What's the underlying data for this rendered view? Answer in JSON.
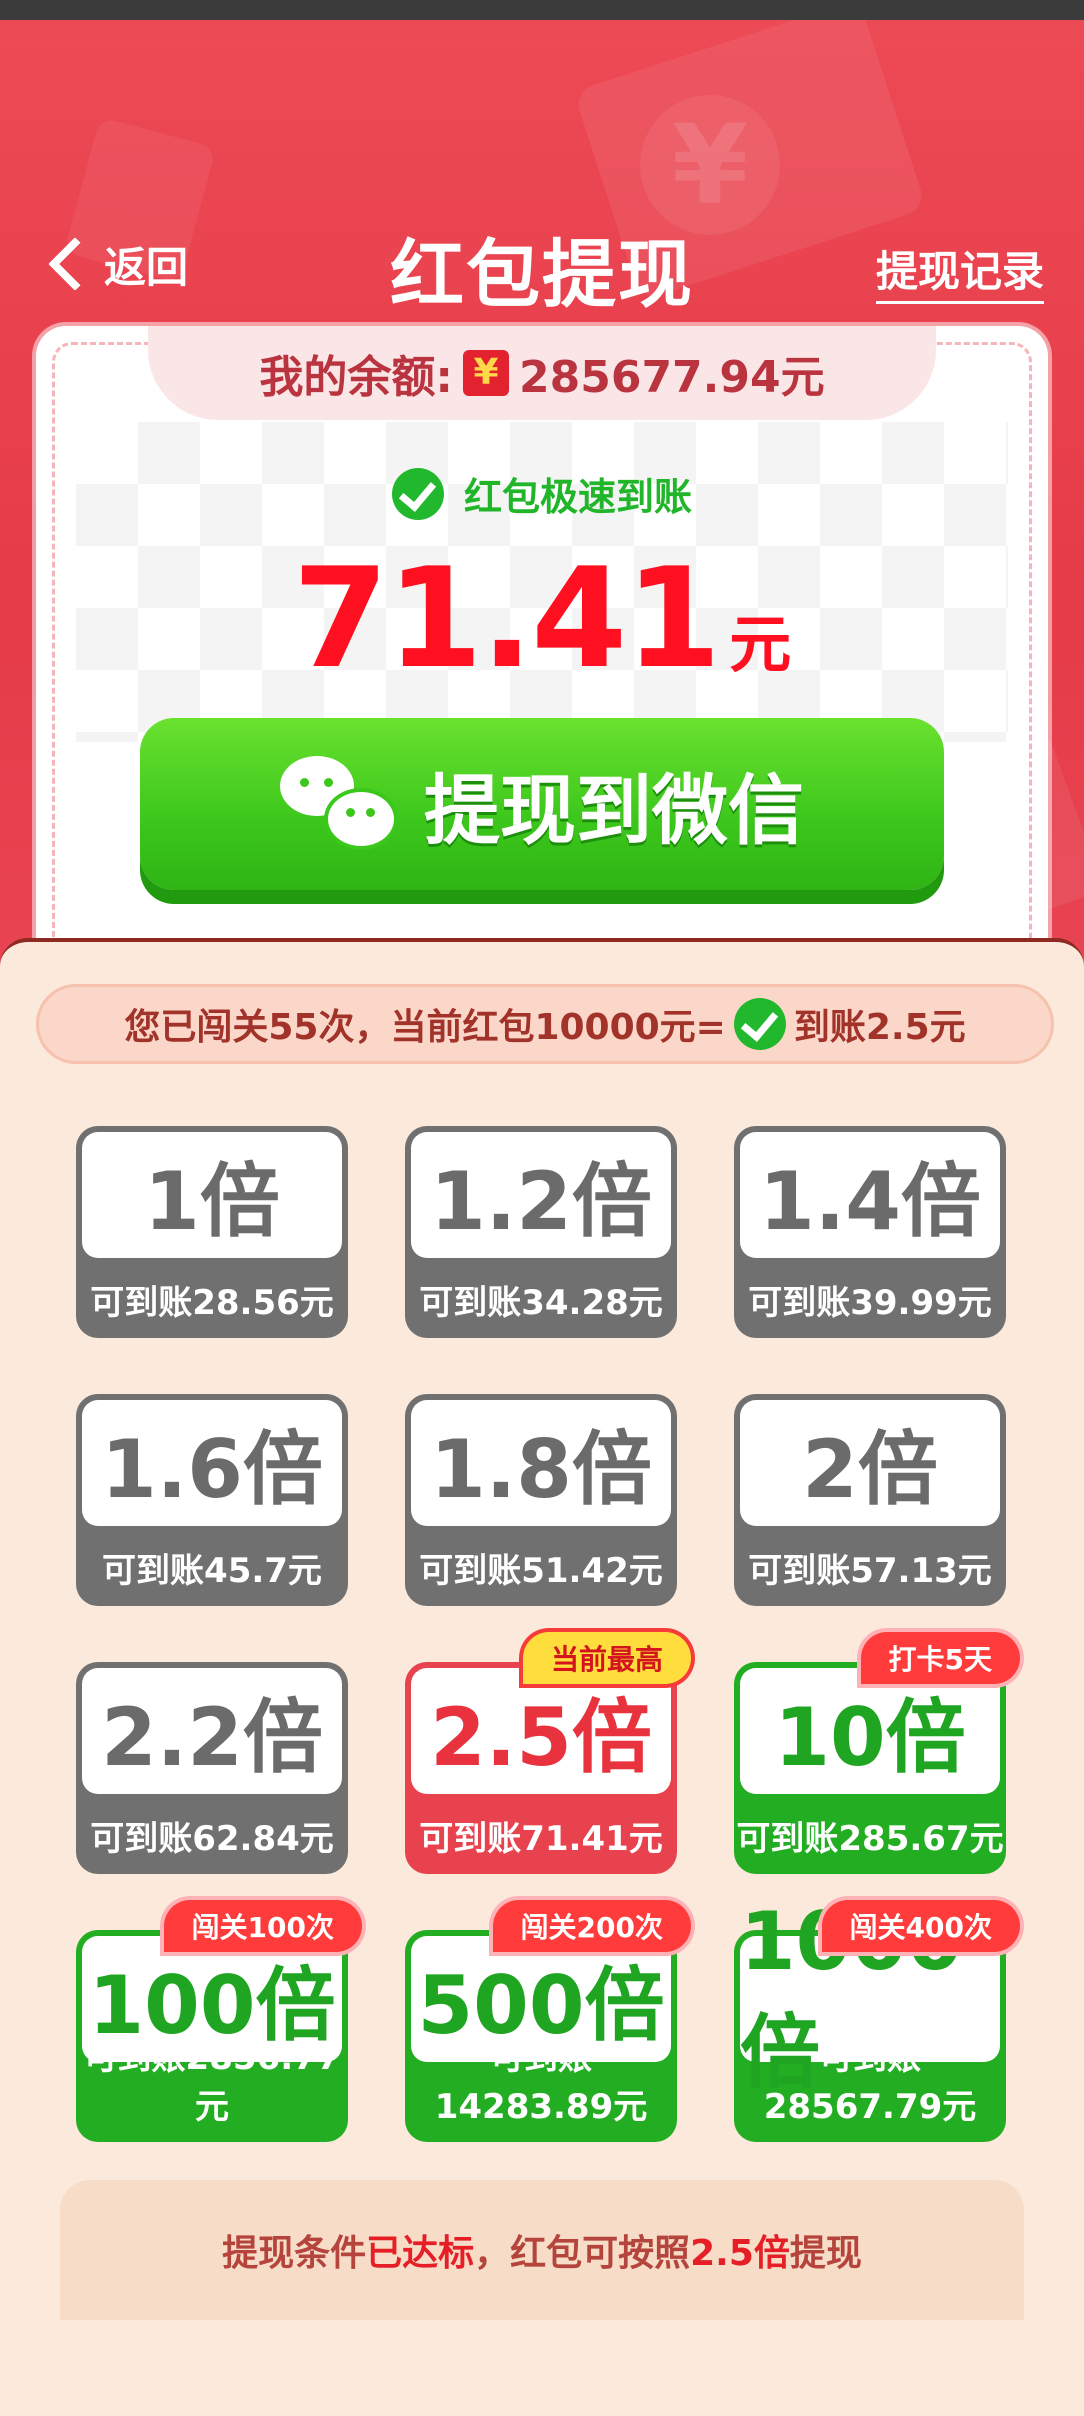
{
  "header": {
    "back_label": "返回",
    "title": "红包提现",
    "record_link": "提现记录"
  },
  "balance": {
    "label": "我的余额:",
    "icon_char": "¥",
    "value": "285677.94元"
  },
  "fast_label": "红包极速到账",
  "amount": {
    "value": "71.41",
    "unit": "元"
  },
  "withdraw_button": "提现到微信",
  "info": {
    "before": "您已闯关55次，当前红包10000元=",
    "after": "到账2.5元"
  },
  "tiles": [
    {
      "mult": "1倍",
      "sub": "可到账28.56元",
      "style": "gray",
      "badge": ""
    },
    {
      "mult": "1.2倍",
      "sub": "可到账34.28元",
      "style": "gray",
      "badge": ""
    },
    {
      "mult": "1.4倍",
      "sub": "可到账39.99元",
      "style": "gray",
      "badge": ""
    },
    {
      "mult": "1.6倍",
      "sub": "可到账45.7元",
      "style": "gray",
      "badge": ""
    },
    {
      "mult": "1.8倍",
      "sub": "可到账51.42元",
      "style": "gray",
      "badge": ""
    },
    {
      "mult": "2倍",
      "sub": "可到账57.13元",
      "style": "gray",
      "badge": ""
    },
    {
      "mult": "2.2倍",
      "sub": "可到账62.84元",
      "style": "gray",
      "badge": ""
    },
    {
      "mult": "2.5倍",
      "sub": "可到账71.41元",
      "style": "red",
      "badge": "当前最高"
    },
    {
      "mult": "10倍",
      "sub": "可到账285.67元",
      "style": "green",
      "badge": "打卡5天"
    },
    {
      "mult": "100倍",
      "sub": "可到账2856.77元",
      "style": "green",
      "badge": "闯关100次"
    },
    {
      "mult": "500倍",
      "sub": "可到账14283.89元",
      "style": "green",
      "badge": "闯关200次"
    },
    {
      "mult": "1000倍",
      "sub": "可到账28567.79元",
      "style": "green",
      "badge": "闯关400次"
    }
  ],
  "footer": {
    "part1": "提现条件",
    "part2": "已达标",
    "part3": "，红包可按照",
    "part4": "2.5倍",
    "part5": "提现"
  },
  "colors": {
    "header_red": "#e63b48",
    "amount_red": "#ff1020",
    "wechat_green": "#3cc71c",
    "tile_gray": "#707070",
    "tile_red": "#e9424f",
    "tile_green": "#23ad22"
  }
}
